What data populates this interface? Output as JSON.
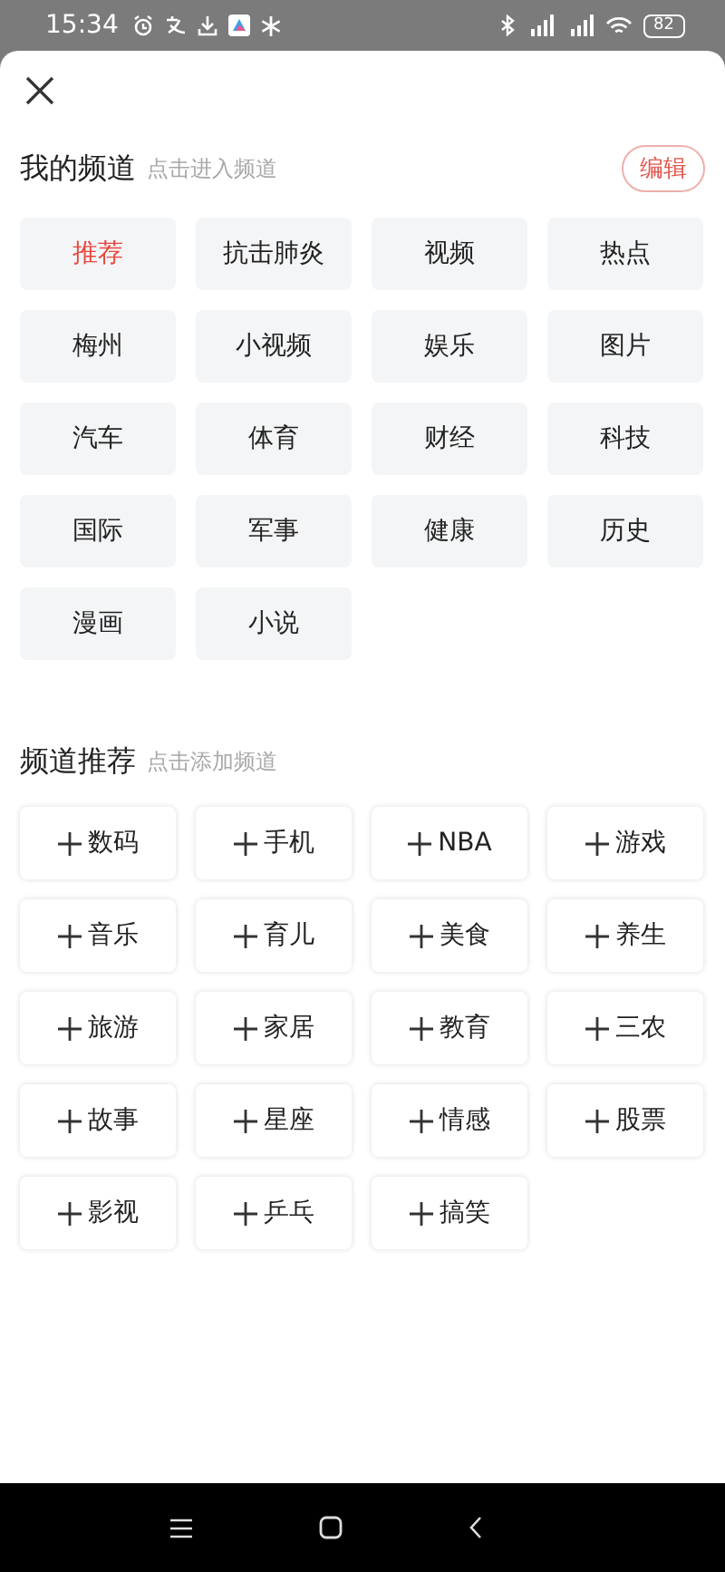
{
  "status_bar": {
    "time": "15:34",
    "battery": "82"
  },
  "my_channels": {
    "title": "我的频道",
    "hint": "点击进入频道",
    "edit_button": "编辑",
    "items": [
      {
        "label": "推荐",
        "selected": true
      },
      {
        "label": "抗击肺炎",
        "selected": false
      },
      {
        "label": "视频",
        "selected": false
      },
      {
        "label": "热点",
        "selected": false
      },
      {
        "label": "梅州",
        "selected": false
      },
      {
        "label": "小视频",
        "selected": false
      },
      {
        "label": "娱乐",
        "selected": false
      },
      {
        "label": "图片",
        "selected": false
      },
      {
        "label": "汽车",
        "selected": false
      },
      {
        "label": "体育",
        "selected": false
      },
      {
        "label": "财经",
        "selected": false
      },
      {
        "label": "科技",
        "selected": false
      },
      {
        "label": "国际",
        "selected": false
      },
      {
        "label": "军事",
        "selected": false
      },
      {
        "label": "健康",
        "selected": false
      },
      {
        "label": "历史",
        "selected": false
      },
      {
        "label": "漫画",
        "selected": false
      },
      {
        "label": "小说",
        "selected": false
      }
    ]
  },
  "recommended": {
    "title": "频道推荐",
    "hint": "点击添加频道",
    "items": [
      {
        "label": "数码"
      },
      {
        "label": "手机"
      },
      {
        "label": "NBA"
      },
      {
        "label": "游戏"
      },
      {
        "label": "音乐"
      },
      {
        "label": "育儿"
      },
      {
        "label": "美食"
      },
      {
        "label": "养生"
      },
      {
        "label": "旅游"
      },
      {
        "label": "家居"
      },
      {
        "label": "教育"
      },
      {
        "label": "三农"
      },
      {
        "label": "故事"
      },
      {
        "label": "星座"
      },
      {
        "label": "情感"
      },
      {
        "label": "股票"
      },
      {
        "label": "影视"
      },
      {
        "label": "乒乓"
      },
      {
        "label": "搞笑"
      }
    ]
  }
}
